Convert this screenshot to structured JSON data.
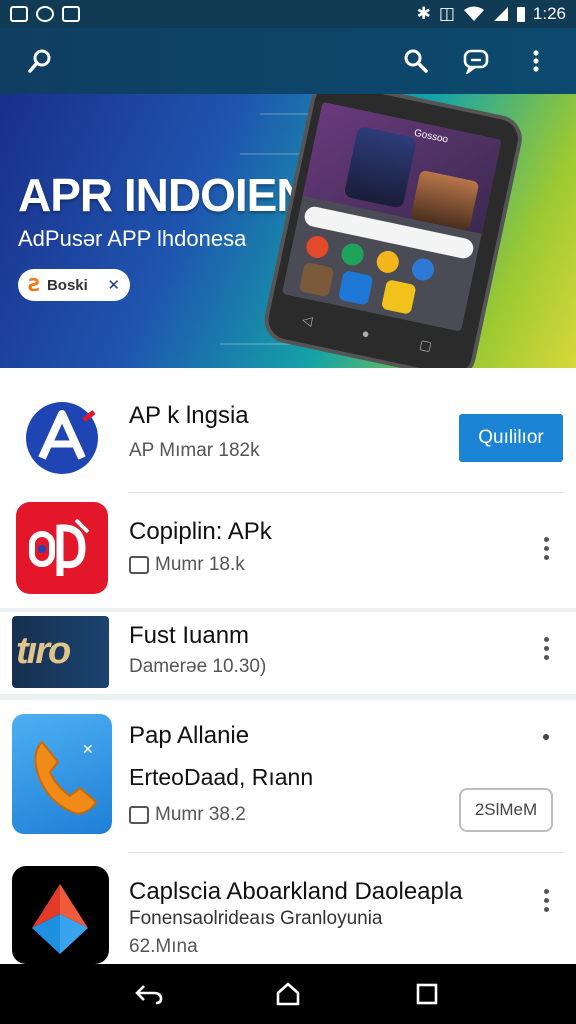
{
  "status_bar": {
    "time": "1:26",
    "icons": [
      "image-icon",
      "notification-icon",
      "gallery-icon",
      "bluetooth-icon",
      "vibrate-icon",
      "wifi-icon",
      "signal-icon",
      "battery-icon"
    ]
  },
  "app_bar": {
    "icons": [
      "search-icon",
      "search-icon",
      "chat-icon",
      "more-vert-icon"
    ]
  },
  "hero": {
    "title": "APR INDOIENSIA",
    "subtitle": "AdPusər APP lhdonesa",
    "pill_label": "Boski",
    "pill_close": "✕",
    "phone_screen_label": "Gossoo"
  },
  "apps": [
    {
      "title": "AP k lngsia",
      "meta": "AP Mımar 182k",
      "action_label": "Quılilıor",
      "icon": "a-logo-icon",
      "icon_colors": [
        "#1f45b5",
        "#ffffff"
      ]
    },
    {
      "title": "Copiplin: APk",
      "meta": "Mumr 18.k",
      "icon": "red-app-icon",
      "icon_colors": [
        "#e3162a",
        "#ffffff"
      ]
    },
    {
      "title": "Fust Iuanm",
      "meta": "Damerəe 10.30)",
      "icon": "tiro-logo-icon",
      "icon_text": "tıro",
      "icon_colors": [
        "#15304f",
        "#e0c48a"
      ]
    },
    {
      "title": "Pap Allanie",
      "subtitle": "ErteoDaad, Rıann",
      "meta": "Mumr 38.2",
      "action_label": "2SlMeM",
      "icon": "phone-call-icon",
      "icon_colors": [
        "#2f8fe0",
        "#f28a18"
      ]
    },
    {
      "title": "Caplscia Aboarkland Daoleapla",
      "subtitle": "Fonensaolrideaıs Granloyunia",
      "meta": "62.Mına",
      "icon": "arrow-logo-icon",
      "icon_colors": [
        "#000000",
        "#e33b2a",
        "#1f8fe0"
      ]
    }
  ],
  "nav": {
    "icons": [
      "back-icon",
      "home-icon",
      "recents-icon"
    ]
  }
}
